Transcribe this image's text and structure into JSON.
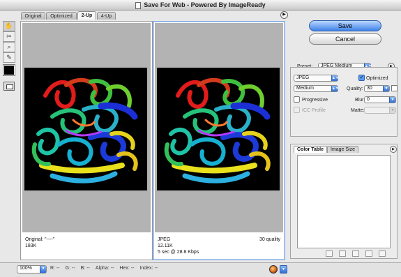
{
  "window": {
    "title": "Save For Web - Powered By ImageReady"
  },
  "tabs": [
    {
      "label": "Original",
      "active": false
    },
    {
      "label": "Optimized",
      "active": false
    },
    {
      "label": "2-Up",
      "active": true
    },
    {
      "label": "4-Up",
      "active": false
    }
  ],
  "tools": [
    {
      "name": "hand-tool",
      "icon": "hand-icon",
      "glyph": "✋"
    },
    {
      "name": "slice-select-tool",
      "icon": "slice-select-icon",
      "glyph": "✂"
    },
    {
      "name": "zoom-tool",
      "icon": "zoom-icon",
      "glyph": "🔍"
    },
    {
      "name": "eyedropper-tool",
      "icon": "eyedropper-icon",
      "glyph": "✎"
    }
  ],
  "panes": {
    "original": {
      "line1": "Original: \"----\"",
      "line2": "183K"
    },
    "optimized": {
      "format": "JPEG",
      "quality_note": "30 quality",
      "size": "12.11K",
      "download": "5 sec @ 28.8 Kbps"
    }
  },
  "buttons": {
    "save": "Save",
    "cancel": "Cancel"
  },
  "settings": {
    "preset_label": "Preset:",
    "preset_value": "JPEG Medium",
    "format_value": "JPEG",
    "optimized_label": "Optimized",
    "optimized_checked": true,
    "quality_preset_value": "Medium",
    "quality_label": "Quality:",
    "quality_value": "30",
    "progressive_label": "Progressive",
    "progressive_checked": false,
    "blur_label": "Blur:",
    "blur_value": "0",
    "icc_label": "ICC Profile",
    "matte_label": "Matte:",
    "matte_value": ""
  },
  "color_table_panel": {
    "tabs": [
      {
        "label": "Color Table",
        "active": true
      },
      {
        "label": "Image Size",
        "active": false
      }
    ]
  },
  "bottom": {
    "zoom": "100%",
    "r_label": "R:",
    "r_value": "--",
    "g_label": "G:",
    "g_value": "--",
    "b_label": "B:",
    "b_value": "--",
    "alpha_label": "Alpha:",
    "alpha_value": "--",
    "hex_label": "Hex:",
    "hex_value": "--",
    "index_label": "Index:",
    "index_value": "--"
  },
  "colors": {
    "accent": "#3f82e8",
    "pane_bg": "#b3b3b3",
    "foreground_color": "#000000"
  }
}
